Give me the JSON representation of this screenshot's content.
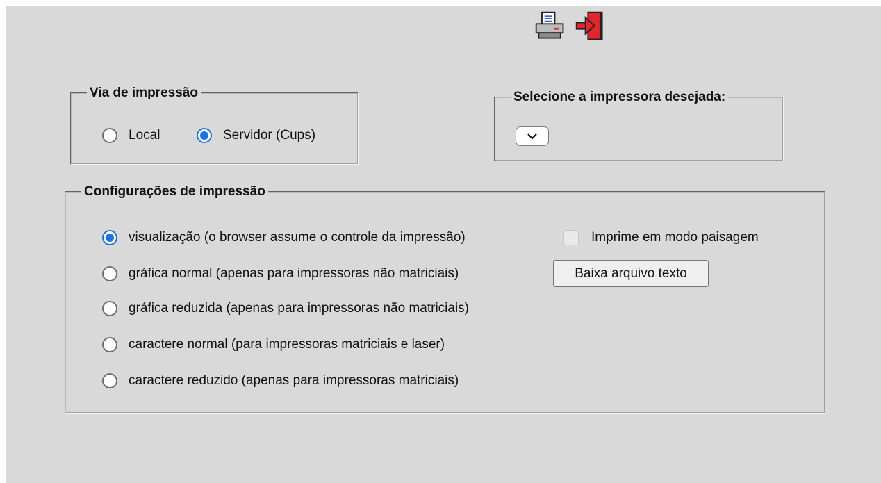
{
  "toolbar": {
    "print_icon": "printer-icon",
    "exit_icon": "exit-door-icon"
  },
  "via": {
    "legend": "Via de impressão",
    "options": [
      "Local",
      "Servidor (Cups)"
    ],
    "selected": "Servidor (Cups)"
  },
  "printer_select": {
    "legend": "Selecione a impressora desejada:",
    "selected_value": ""
  },
  "config": {
    "legend": "Configurações de impressão",
    "options": [
      "visualização (o browser assume o controle da impressão)",
      "gráfica normal (apenas para impressoras não matriciais)",
      "gráfica reduzida (apenas para impressoras não matriciais)",
      "caractere normal (para impressoras matriciais e laser)",
      "caractere reduzido (apenas para impressoras matriciais)"
    ],
    "selected": "visualização (o browser assume o controle da impressão)",
    "landscape_label": "Imprime em modo paisagem",
    "landscape_checked": false,
    "download_button": "Baixa arquivo texto"
  },
  "colors": {
    "background": "#d9d9d9",
    "accent": "#1a73e8",
    "exit_red": "#e3262b"
  }
}
